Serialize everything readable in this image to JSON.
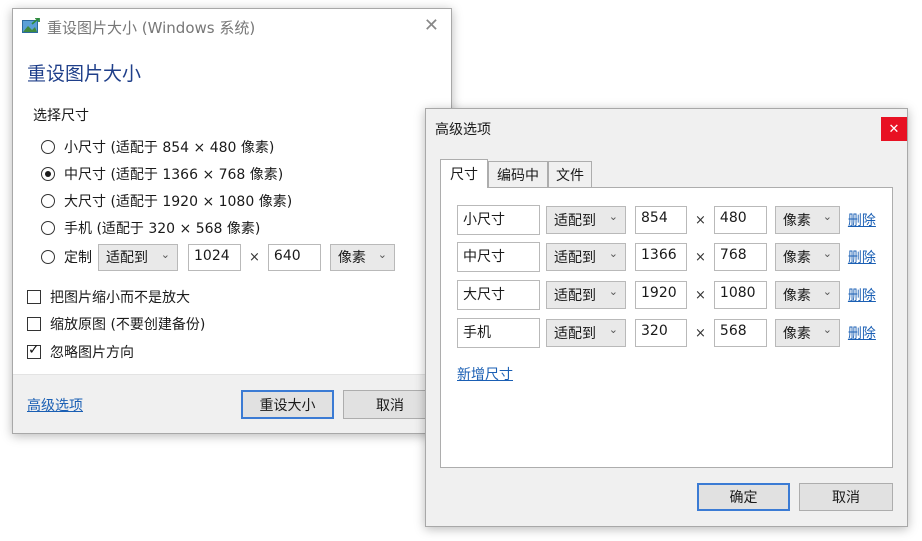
{
  "main": {
    "window_title": "重设图片大小 (Windows 系统)",
    "heading": "重设图片大小",
    "section_label": "选择尺寸",
    "options": [
      {
        "label": "小尺寸 (适配于 854 × 480 像素)",
        "checked": false
      },
      {
        "label": "中尺寸 (适配于 1366 × 768 像素)",
        "checked": true
      },
      {
        "label": "大尺寸 (适配于 1920 × 1080 像素)",
        "checked": false
      },
      {
        "label": "手机 (适配于 320 × 568 像素)",
        "checked": false
      }
    ],
    "custom": {
      "label": "定制",
      "mode": "适配到",
      "width": "1024",
      "times": "×",
      "height": "640",
      "unit": "像素"
    },
    "checks": [
      {
        "label": "把图片缩小而不是放大",
        "checked": false
      },
      {
        "label": "缩放原图 (不要创建备份)",
        "checked": false
      },
      {
        "label": "忽略图片方向",
        "checked": true
      }
    ],
    "advanced_link": "高级选项",
    "resize_button": "重设大小",
    "cancel_button": "取消",
    "close_glyph": "✕"
  },
  "advanced": {
    "title": "高级选项",
    "close_glyph": "✕",
    "tabs": [
      "尺寸",
      "编码中",
      "文件"
    ],
    "rows": [
      {
        "name": "小尺寸",
        "mode": "适配到",
        "width": "854",
        "height": "480",
        "unit": "像素",
        "delete": "删除"
      },
      {
        "name": "中尺寸",
        "mode": "适配到",
        "width": "1366",
        "height": "768",
        "unit": "像素",
        "delete": "删除"
      },
      {
        "name": "大尺寸",
        "mode": "适配到",
        "width": "1920",
        "height": "1080",
        "unit": "像素",
        "delete": "删除"
      },
      {
        "name": "手机",
        "mode": "适配到",
        "width": "320",
        "height": "568",
        "unit": "像素",
        "delete": "删除"
      }
    ],
    "times": "×",
    "add_size": "新增尺寸",
    "ok_button": "确定",
    "cancel_button": "取消"
  },
  "icons": {
    "dropdown": "chevron-down-icon",
    "app": "image-resize-icon"
  },
  "colors": {
    "heading": "#1f3f8a",
    "link": "#1a5fb4",
    "close_red": "#e81123",
    "default_border": "#3b7bd4"
  }
}
